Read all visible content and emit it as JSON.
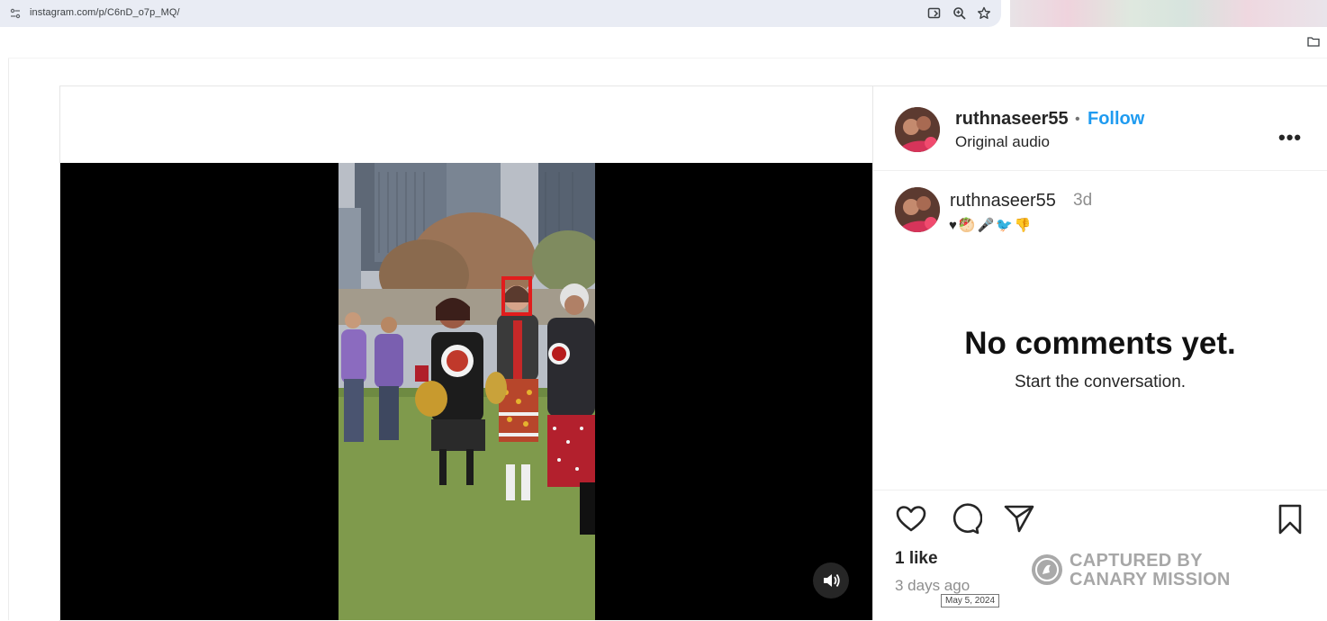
{
  "browser": {
    "url": "instagram.com/p/C6nD_o7p_MQ/",
    "icons": [
      "site-settings-icon",
      "open-in-app-icon",
      "zoom-icon",
      "bookmark-star-icon",
      "bookmark-folder-icon"
    ]
  },
  "post": {
    "username": "ruthnaseer55",
    "separator": "•",
    "follow_label": "Follow",
    "audio_label": "Original audio",
    "more_label": "•••"
  },
  "caption": {
    "username": "ruthnaseer55",
    "time": "3d",
    "emojis": "♥🥙🎤🐦👎"
  },
  "comments": {
    "empty_title": "No comments yet.",
    "empty_subtitle": "Start the conversation."
  },
  "actions": {
    "icons": [
      "heart-icon",
      "comment-icon",
      "share-icon",
      "save-icon"
    ],
    "likes": "1 like",
    "posted_ago": "3 days ago",
    "date_tooltip": "May 5, 2024"
  },
  "watermark": {
    "line1": "CAPTURED BY",
    "line2": "CANARY MISSION"
  },
  "colors": {
    "follow": "#1f9bf0",
    "highlight_box": "#e11d1d",
    "video_bg": "#000000"
  }
}
